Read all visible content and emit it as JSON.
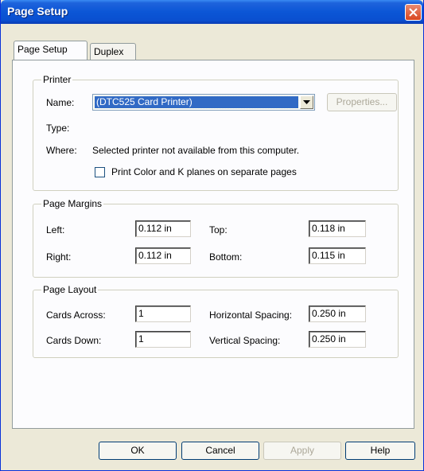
{
  "window": {
    "title": "Page Setup",
    "close_icon": "close-x-icon"
  },
  "tabs": [
    {
      "label": "Page Setup",
      "active": true
    },
    {
      "label": "Duplex",
      "active": false
    }
  ],
  "printer": {
    "group_title": "Printer",
    "name_label": "Name:",
    "name_value": "(DTC525 Card Printer)",
    "properties_label": "Properties...",
    "type_label": "Type:",
    "where_label": "Where:",
    "where_value": "Selected printer not available from this computer.",
    "separate_pages_label": "Print Color and K planes on separate pages",
    "separate_pages_checked": false
  },
  "margins": {
    "group_title": "Page Margins",
    "left_label": "Left:",
    "left_value": "0.112 in",
    "top_label": "Top:",
    "top_value": "0.118 in",
    "right_label": "Right:",
    "right_value": "0.112 in",
    "bottom_label": "Bottom:",
    "bottom_value": "0.115 in"
  },
  "layout": {
    "group_title": "Page Layout",
    "cards_across_label": "Cards Across:",
    "cards_across_value": "1",
    "cards_down_label": "Cards Down:",
    "cards_down_value": "1",
    "hspacing_label": "Horizontal Spacing:",
    "hspacing_value": "0.250 in",
    "vspacing_label": "Vertical Spacing:",
    "vspacing_value": "0.250 in"
  },
  "buttons": {
    "ok": "OK",
    "cancel": "Cancel",
    "apply": "Apply",
    "help": "Help"
  }
}
